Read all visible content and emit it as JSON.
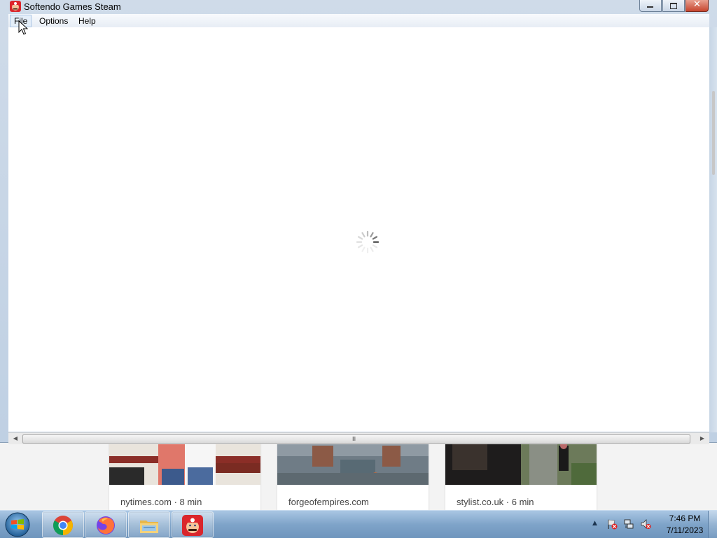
{
  "window": {
    "title": "Softendo Games Steam",
    "controls": [
      "minimize",
      "maximize",
      "close"
    ],
    "close_glyph": "✕"
  },
  "menubar": {
    "items": [
      "File",
      "Options",
      "Help"
    ]
  },
  "content": {
    "state": "loading",
    "icon": "loading-spinner-icon"
  },
  "scrollbar": {
    "left_arrow": "◀",
    "right_arrow": "▶",
    "grip": "III"
  },
  "feed": {
    "cards": [
      {
        "caption": "nytimes.com · 8 min"
      },
      {
        "caption": "forgeofempires.com"
      },
      {
        "caption": "stylist.co.uk · 6 min"
      }
    ]
  },
  "taskbar": {
    "apps": [
      "windows-start-icon",
      "chrome-icon",
      "firefox-icon",
      "file-explorer-icon",
      "mario-games-icon"
    ],
    "tray_arrow": "▲",
    "tray_icons": [
      "action-center-flag-icon",
      "network-icon",
      "volume-muted-icon"
    ],
    "clock": {
      "time": "7:46 PM",
      "date": "7/11/2023"
    }
  }
}
